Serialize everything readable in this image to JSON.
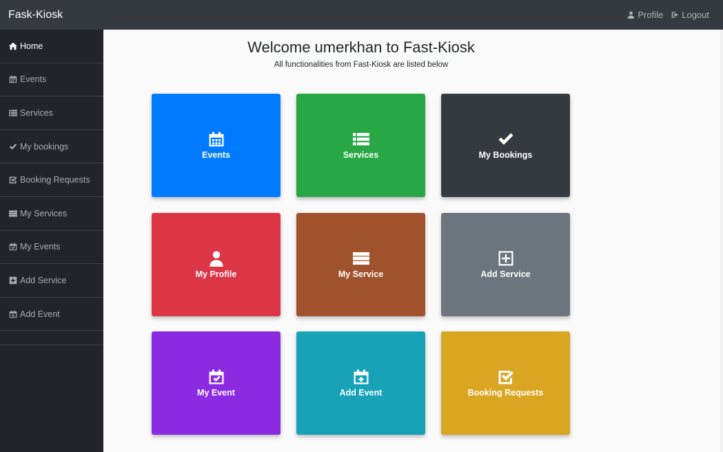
{
  "header": {
    "brand": "Fask-Kiosk",
    "profile_label": "Profile",
    "logout_label": "Logout"
  },
  "sidebar": {
    "items": [
      {
        "label": "Home",
        "icon": "home-icon"
      },
      {
        "label": "Events",
        "icon": "calendar-icon"
      },
      {
        "label": "Services",
        "icon": "list-icon"
      },
      {
        "label": "My bookings",
        "icon": "check-icon"
      },
      {
        "label": "Booking Requests",
        "icon": "check-square-icon"
      },
      {
        "label": "My Services",
        "icon": "server-icon"
      },
      {
        "label": "My Events",
        "icon": "calendar-check-icon"
      },
      {
        "label": "Add Service",
        "icon": "plus-square-icon"
      },
      {
        "label": "Add Event",
        "icon": "calendar-plus-icon"
      }
    ]
  },
  "main": {
    "title": "Welcome umerkhan to Fast-Kiosk",
    "subtitle": "All functionalities from Fast-Kiosk are listed below",
    "tiles": [
      {
        "label": "Events",
        "icon": "calendar-icon",
        "color": "#007bff"
      },
      {
        "label": "Services",
        "icon": "list-icon",
        "color": "#28a745"
      },
      {
        "label": "My Bookings",
        "icon": "check-icon",
        "color": "#343a40"
      },
      {
        "label": "My Profile",
        "icon": "user-icon",
        "color": "#dc3545"
      },
      {
        "label": "My Service",
        "icon": "server-icon",
        "color": "#a0522d"
      },
      {
        "label": "Add Service",
        "icon": "plus-square-icon",
        "color": "#6c757d"
      },
      {
        "label": "My Event",
        "icon": "calendar-check-icon",
        "color": "#8a2be2"
      },
      {
        "label": "Add Event",
        "icon": "calendar-plus-icon",
        "color": "#17a2b8"
      },
      {
        "label": "Booking Requests",
        "icon": "check-square-icon",
        "color": "#daa520"
      }
    ]
  }
}
